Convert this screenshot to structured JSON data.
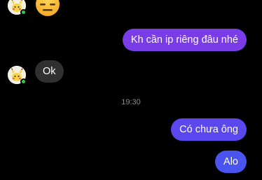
{
  "conversation": {
    "messages": [
      {
        "direction": "incoming",
        "type": "emoji",
        "emoji": "expressionless-face"
      },
      {
        "direction": "outgoing",
        "text": "Kh cần ip riêng đâu nhé"
      },
      {
        "direction": "incoming",
        "text": "Ok"
      },
      {
        "type": "timestamp",
        "text": "19:30"
      },
      {
        "direction": "outgoing",
        "text": "Có chưa ông"
      },
      {
        "direction": "outgoing",
        "text": "Alo"
      }
    ],
    "contact": {
      "avatar": "pikachu-avatar",
      "online": true
    }
  },
  "colors": {
    "background": "#000000",
    "incoming_bubble": "#303030",
    "outgoing_top": "#7a3ce6",
    "outgoing_mid": "#5a48ee",
    "outgoing_bottom": "#4a55f0",
    "online_dot": "#31cc46",
    "timestamp_text": "#8a8a8a"
  }
}
